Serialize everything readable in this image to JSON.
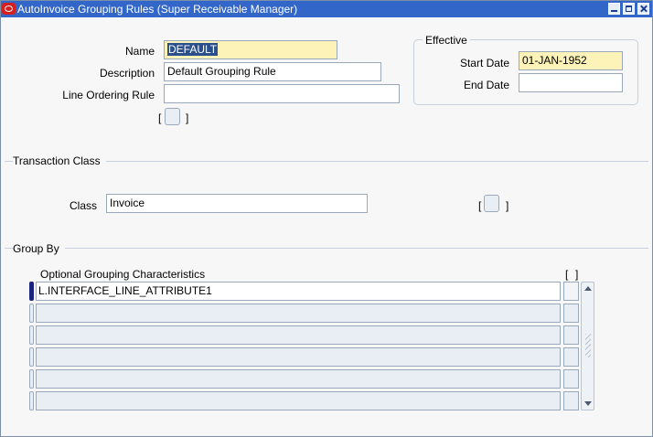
{
  "window": {
    "title": "AutoInvoice Grouping Rules (Super Receivable Manager)"
  },
  "header": {
    "name_label": "Name",
    "name_value": "DEFAULT",
    "description_label": "Description",
    "description_value": "Default Grouping Rule",
    "line_ordering_label": "Line Ordering Rule",
    "line_ordering_value": "",
    "bracket_open": "[",
    "bracket_close": "]"
  },
  "effective": {
    "group_title": "Effective",
    "start_date_label": "Start Date",
    "start_date_value": "01-JAN-1952",
    "end_date_label": "End Date",
    "end_date_value": ""
  },
  "transaction_class": {
    "section_title": "Transaction Class",
    "class_label": "Class",
    "class_value": "Invoice",
    "bracket_open": "[",
    "bracket_close": "]"
  },
  "group_by": {
    "section_title": "Group By",
    "column_header": "Optional Grouping Characteristics",
    "bracket_open": "[",
    "bracket_close": "]",
    "rows": [
      "L.INTERFACE_LINE_ATTRIBUTE1",
      "",
      "",
      "",
      "",
      ""
    ]
  },
  "colors": {
    "titlebar": "#3266c8",
    "required_field": "#fdf2b7",
    "current_record": "#1a237e",
    "brand_icon": "#d42020"
  },
  "icons": {
    "app": "oracle-logo-icon",
    "minimize": "minimize-icon",
    "maximize": "maximize-icon",
    "close": "close-icon"
  }
}
